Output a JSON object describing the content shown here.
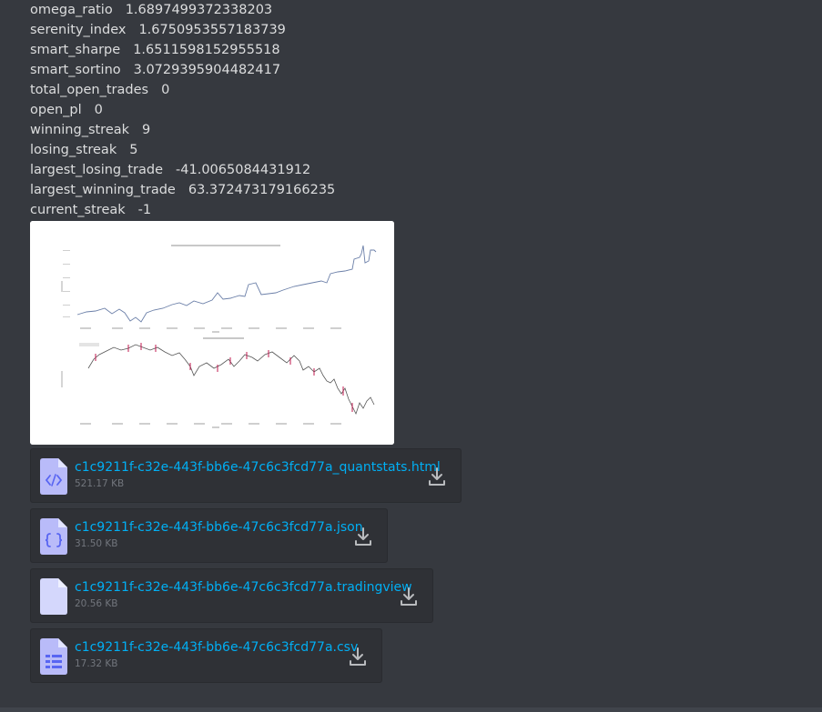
{
  "stats": [
    {
      "key": "omega_ratio",
      "value": "1.6897499372338203"
    },
    {
      "key": "serenity_index",
      "value": "1.6750953557183739"
    },
    {
      "key": "smart_sharpe",
      "value": "1.6511598152955518"
    },
    {
      "key": "smart_sortino",
      "value": "3.0729395904482417"
    },
    {
      "key": "total_open_trades",
      "value": "0"
    },
    {
      "key": "open_pl",
      "value": "0"
    },
    {
      "key": "winning_streak",
      "value": "9"
    },
    {
      "key": "losing_streak",
      "value": "5"
    },
    {
      "key": "largest_losing_trade",
      "value": "-41.0065084431912"
    },
    {
      "key": "largest_winning_trade",
      "value": "63.372473179166235"
    },
    {
      "key": "current_streak",
      "value": "-1"
    }
  ],
  "attachments": [
    {
      "name": "c1c9211f-c32e-443f-bb6e-47c6c3fcd77a_quantstats.html",
      "size": "521.17 KB",
      "icon": "code-file-icon"
    },
    {
      "name": "c1c9211f-c32e-443f-bb6e-47c6c3fcd77a.json",
      "size": "31.50 KB",
      "icon": "json-file-icon"
    },
    {
      "name": "c1c9211f-c32e-443f-bb6e-47c6c3fcd77a.tradingview",
      "size": "20.56 KB",
      "icon": "blank-file-icon"
    },
    {
      "name": "c1c9211f-c32e-443f-bb6e-47c6c3fcd77a.csv",
      "size": "17.32 KB",
      "icon": "spreadsheet-file-icon"
    }
  ],
  "colors": {
    "background": "#36393f",
    "attachment_bg": "#2f3136",
    "link": "#00aff4",
    "file_icon": "#b9bbf9",
    "file_icon_glyph": "#5865f2"
  }
}
